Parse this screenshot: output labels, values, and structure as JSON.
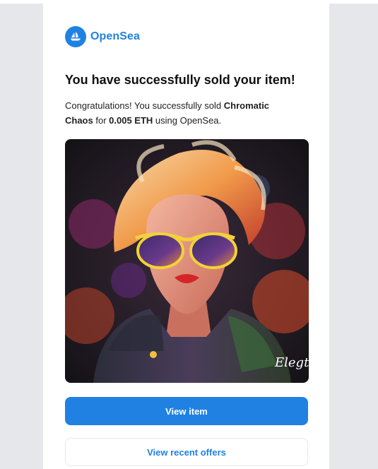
{
  "brand": {
    "name": "OpenSea",
    "logo_icon": "opensea-boat-icon",
    "color": "#2081e2"
  },
  "email": {
    "title": "You have successfully sold your item!",
    "message": {
      "prefix": "Congratulations! You successfully sold ",
      "item_name": "Chromatic Chaos",
      "middle": " for ",
      "price": "0.005 ETH",
      "suffix": " using OpenSea."
    },
    "image": {
      "subject": "pop-art portrait with yellow sunglasses",
      "signature": "Elegt"
    }
  },
  "actions": {
    "view_item_label": "View item",
    "view_offers_label": "View recent offers"
  },
  "colors": {
    "primary": "#2081e2",
    "background": "#e8eaed",
    "card": "#ffffff"
  }
}
